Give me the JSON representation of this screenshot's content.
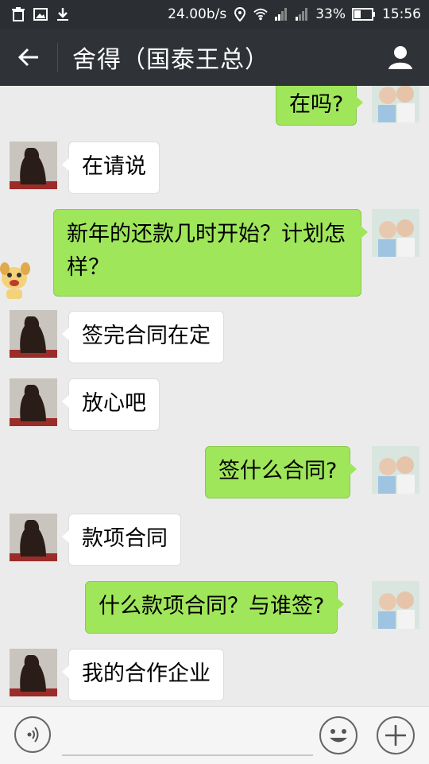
{
  "status_bar": {
    "speed": "24.00b/s",
    "battery": "33%",
    "time": "15:56",
    "icons": [
      "trash-icon",
      "image-icon",
      "download-icon",
      "location-icon",
      "wifi-icon",
      "signal-icon",
      "signal-icon",
      "battery-icon"
    ]
  },
  "header": {
    "title": "舍得（国泰王总）",
    "back_icon": "back-arrow-icon",
    "profile_icon": "person-icon"
  },
  "messages": [
    {
      "side": "out",
      "text": "在吗?"
    },
    {
      "side": "in",
      "text": "在请说"
    },
    {
      "side": "out",
      "text": "新年的还款几时开始？计划怎样？"
    },
    {
      "side": "in",
      "text": "签完合同在定"
    },
    {
      "side": "in",
      "text": "放心吧"
    },
    {
      "side": "out",
      "text": "签什么合同?"
    },
    {
      "side": "in",
      "text": "款项合同"
    },
    {
      "side": "out",
      "text": "什么款项合同？与谁签?"
    },
    {
      "side": "in",
      "text": "我的合作企业"
    }
  ],
  "input_bar": {
    "voice_icon": "voice-icon",
    "emoji_icon": "smiley-icon",
    "plus_icon": "plus-icon",
    "input_value": ""
  },
  "colors": {
    "status_bg": "#2b2f33",
    "header_bg": "#2f3338",
    "chat_bg": "#ebebeb",
    "outgoing_bubble": "#9fe65a",
    "incoming_bubble": "#ffffff"
  }
}
